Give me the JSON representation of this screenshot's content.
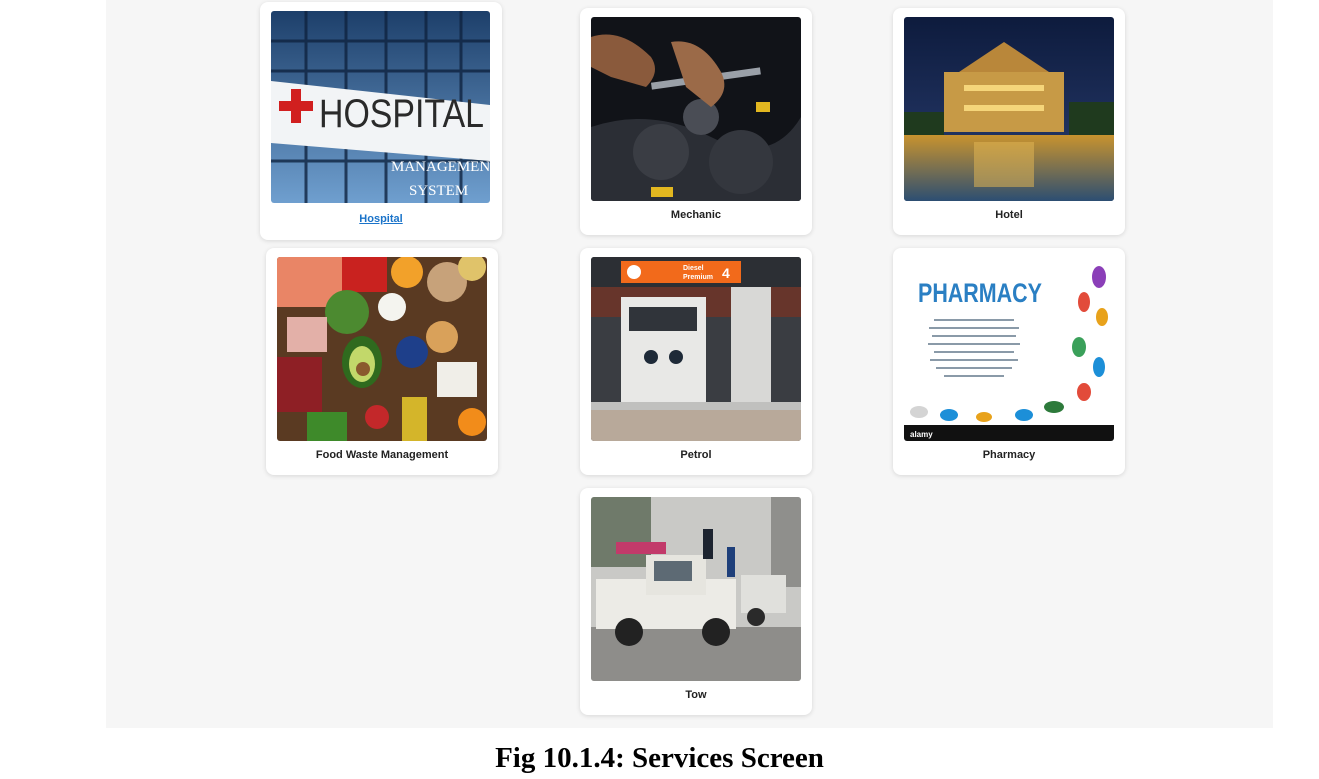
{
  "services": [
    {
      "label": "Hospital",
      "icon": "hospital-building-photo",
      "is_link": true
    },
    {
      "label": "Mechanic",
      "icon": "engine-repair-photo"
    },
    {
      "label": "Hotel",
      "icon": "hotel-night-photo"
    },
    {
      "label": "Food Waste Management",
      "icon": "fresh-food-photo"
    },
    {
      "label": "Petrol",
      "icon": "fuel-pump-photo"
    },
    {
      "label": "Pharmacy",
      "icon": "pharmacy-pills-photo"
    },
    {
      "label": "Tow",
      "icon": "tow-truck-photo"
    }
  ],
  "hospital_image": {
    "line1": "HOSPITAL",
    "line2": "MANAGEMENT",
    "line3": "SYSTEM"
  },
  "petrol_image": {
    "sign_line1": "Diesel",
    "sign_line2": "Premium",
    "sign_number": "4"
  },
  "pharmacy_image": {
    "title": "PHARMACY",
    "brand": "alamy"
  },
  "caption": "Fig 10.1.4: Services Screen",
  "colors": {
    "link": "#1a73c9",
    "screen_bg": "#f6f6f6",
    "card_bg": "#ffffff"
  }
}
